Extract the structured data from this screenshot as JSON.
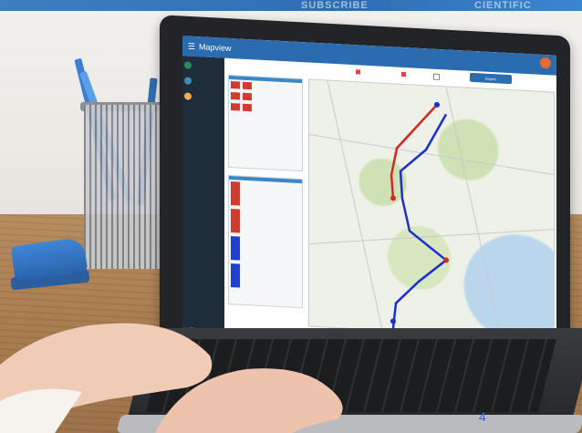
{
  "banner": {
    "ghost_left": "SUBSCRIBE",
    "ghost_right": "CIENTIFIC"
  },
  "app": {
    "title": "Mapview",
    "sidebar": [
      {
        "color": "#2e8b57"
      },
      {
        "color": "#3c8dbc"
      },
      {
        "color": "#f0ad4e"
      }
    ],
    "toolbar_export": "Export",
    "colors": {
      "route_red": "#d22a1f",
      "route_blue": "#1d2fd0",
      "header": "#2b6cb0"
    }
  },
  "footer": {
    "page_number": "4"
  }
}
